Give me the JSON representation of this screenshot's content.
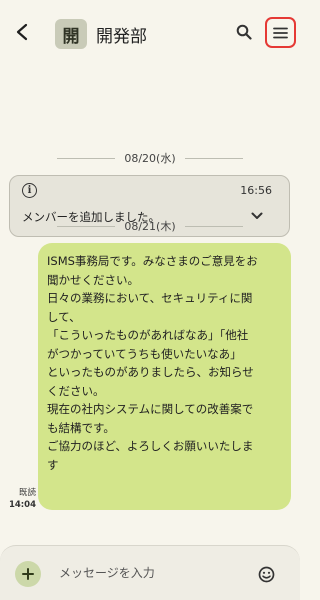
{
  "header": {
    "back_icon": "back-arrow-icon",
    "avatar_initial": "開",
    "title": "開発部",
    "search_icon": "search-icon",
    "menu_icon": "hamburger-menu-icon"
  },
  "dividers": [
    {
      "date": "08/20(水)"
    },
    {
      "date": "08/21(木)"
    }
  ],
  "system_message": {
    "icon": "info-icon",
    "time": "16:56",
    "text": "メンバーを追加しました。",
    "expand_icon": "chevron-down-icon"
  },
  "message": {
    "read_label": "既読",
    "time": "14:04",
    "lines": [
      "ISMS事務局です。みなさまのご意見をお",
      "聞かせください。",
      "日々の業務において、セキュリティに関",
      "して、",
      "「こういったものがあればなあ」「他社",
      "がつかっていてうちも使いたいなあ」",
      "といったものがありましたら、お知らせ",
      "ください。",
      "現在の社内システムに関しての改善案で",
      "も結構です。",
      "ご協力のほど、よろしくお願いいたしま",
      "す"
    ],
    "bubble_color": "#d3e58b"
  },
  "composer": {
    "add_icon": "plus-icon",
    "placeholder": "メッセージを入力",
    "emoji_icon": "emoji-icon"
  },
  "colors": {
    "background": "#f7f5ec",
    "highlight_border": "#e53935"
  }
}
